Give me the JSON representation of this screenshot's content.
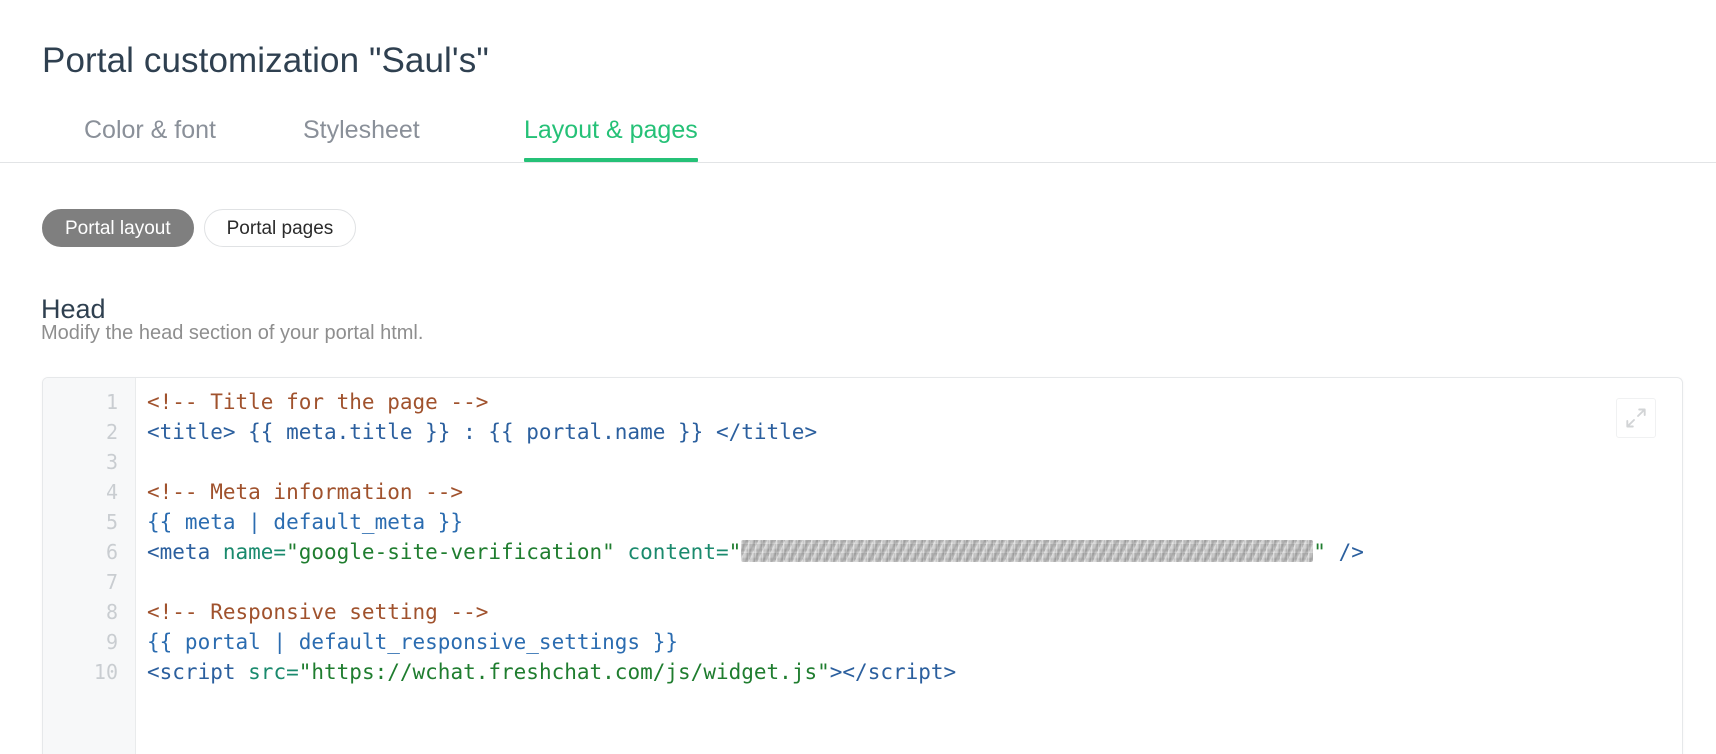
{
  "page": {
    "title": "Portal customization \"Saul's\""
  },
  "tabs": {
    "items": [
      {
        "label": "Color & font",
        "active": false
      },
      {
        "label": "Stylesheet",
        "active": false
      },
      {
        "label": "Layout & pages",
        "active": true
      }
    ],
    "accent_color": "#25c177",
    "inactive_color": "#8a9099"
  },
  "pills": {
    "items": [
      {
        "label": "Portal layout",
        "active": true
      },
      {
        "label": "Portal pages",
        "active": false
      }
    ],
    "active_background": "#7f7f7f",
    "active_text": "#ffffff"
  },
  "section": {
    "heading": "Head",
    "description": "Modify the head section of your portal html."
  },
  "editor": {
    "expand_icon": "expand-arrows-icon",
    "line_numbers": [
      "1",
      "2",
      "3",
      "4",
      "5",
      "6",
      "7",
      "8",
      "9",
      "10"
    ],
    "lines": [
      {
        "n": "1",
        "text": "<!-- Title for the page -->"
      },
      {
        "n": "2",
        "text": "<title> {{ meta.title }} : {{ portal.name }} </title>"
      },
      {
        "n": "3",
        "text": ""
      },
      {
        "n": "4",
        "text": "<!-- Meta information -->"
      },
      {
        "n": "5",
        "text": "{{ meta | default_meta }}"
      },
      {
        "n": "6",
        "text": "<meta name=\"google-site-verification\" content=\"[redacted]\" />"
      },
      {
        "n": "7",
        "text": ""
      },
      {
        "n": "8",
        "text": "<!-- Responsive setting -->"
      },
      {
        "n": "9",
        "text": "{{ portal | default_responsive_settings }}"
      },
      {
        "n": "10",
        "text": "<script src=\"https://wchat.freshchat.com/js/widget.js\"></script>"
      }
    ],
    "line6": {
      "open_tag": "<meta",
      "attr_name": " name=",
      "attr_name_value": "\"google-site-verification\"",
      "attr_content": " content=",
      "quote_open": "\"",
      "redacted_value": "[redacted]",
      "quote_close": "\"",
      "close_tag": " />"
    },
    "line10": {
      "open_tag": "<script",
      "attr": " src=",
      "value": "\"https://wchat.freshchat.com/js/widget.js\"",
      "gt": ">",
      "close_tag": "</script>"
    },
    "colors": {
      "comment": "#a0522d",
      "tag": "#2b5f9e",
      "attribute": "#1a8a6d",
      "string": "#1f7d2f",
      "template": "#2b6cb0",
      "gutter_background": "#f7f8f9",
      "line_number": "#c9cdd1"
    }
  }
}
